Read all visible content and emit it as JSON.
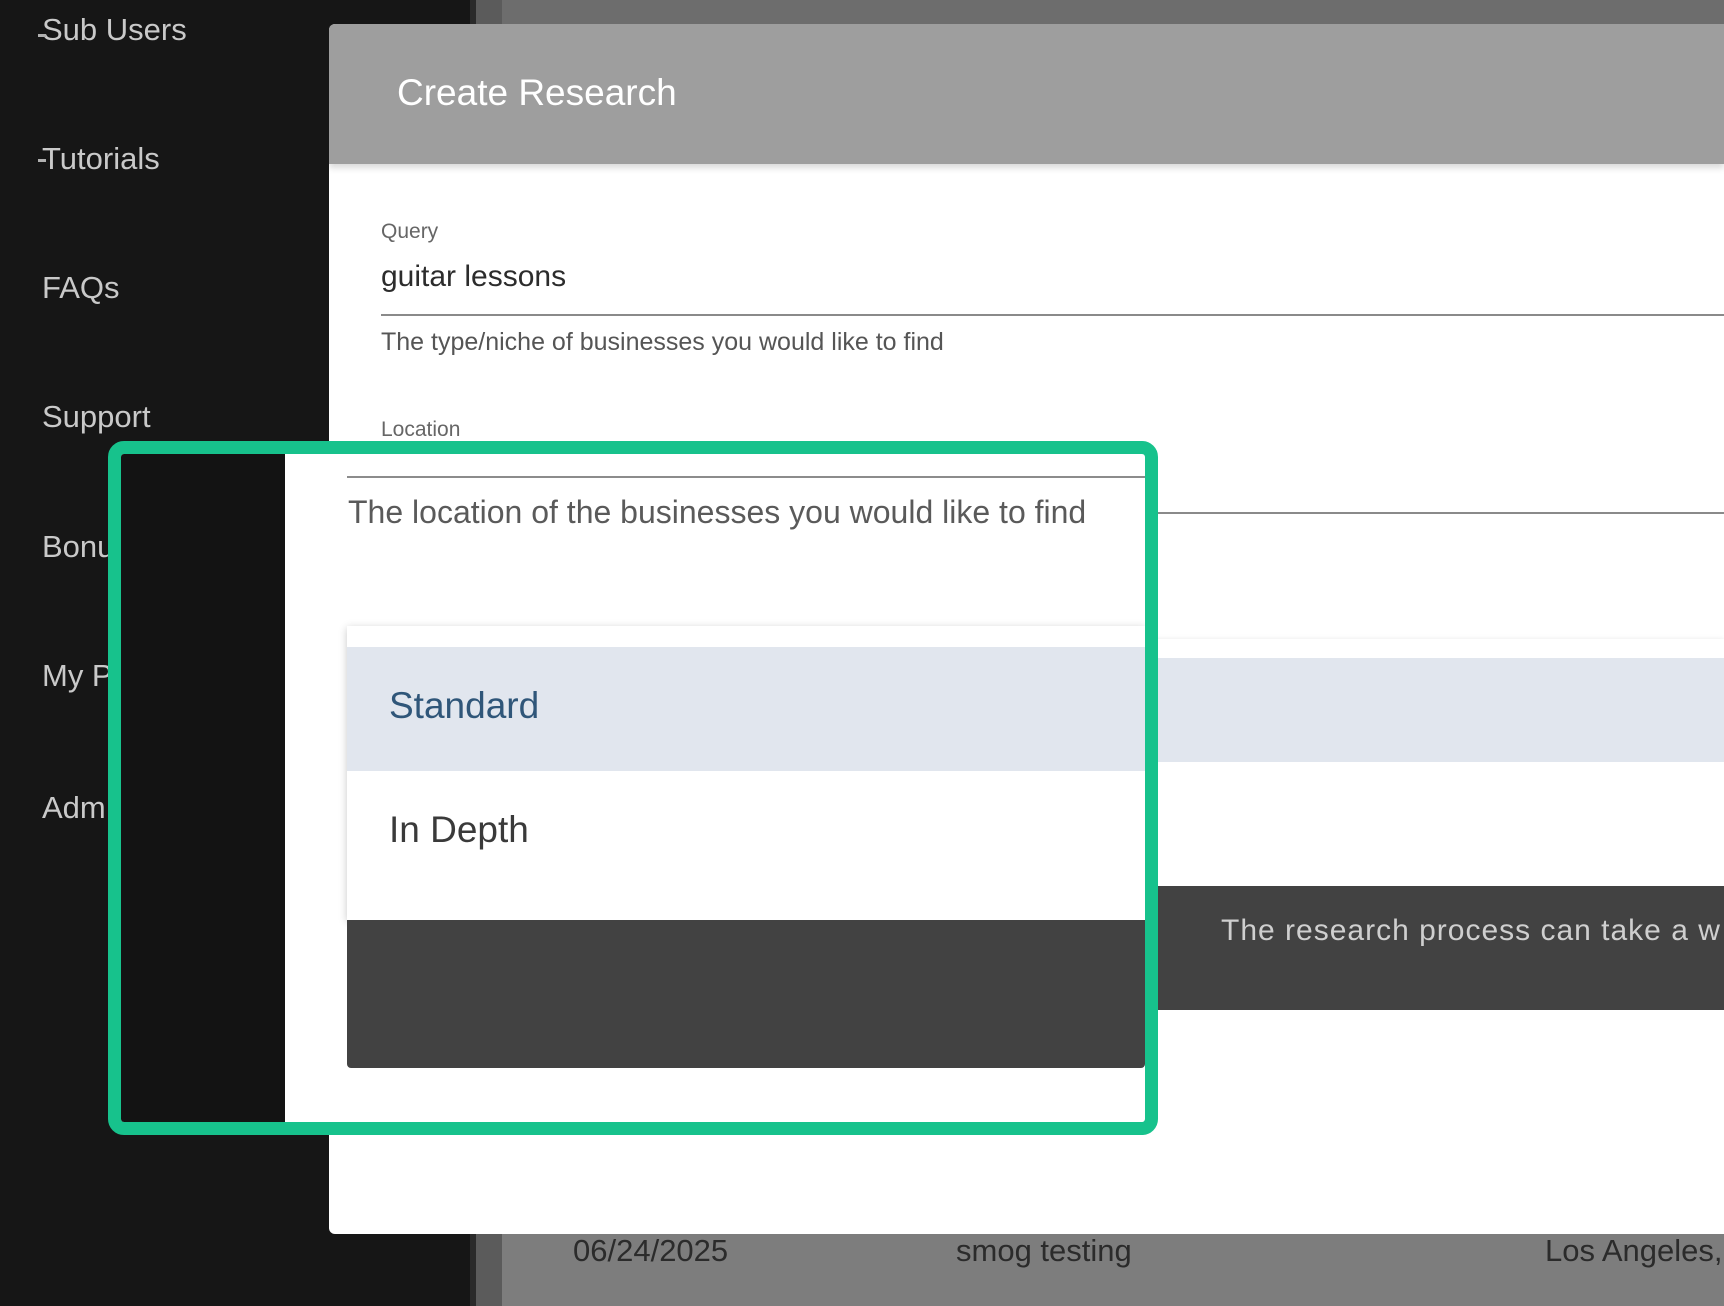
{
  "sidebar": {
    "items": [
      {
        "label": "Sub Users"
      },
      {
        "label": "Tutorials"
      },
      {
        "label": "FAQs"
      },
      {
        "label": "Support"
      },
      {
        "label": "Bonu"
      },
      {
        "label": "My P"
      },
      {
        "label": "Adm"
      }
    ]
  },
  "modal": {
    "title": "Create Research",
    "query": {
      "label": "Query",
      "value": "guitar lessons",
      "hint": "The type/niche of businesses you would like to find"
    },
    "location": {
      "label": "Location",
      "hint": "The location of the businesses you would like to find"
    },
    "research_type": {
      "options": [
        "Standard",
        "In Depth"
      ],
      "selected": "Standard"
    },
    "notice": "The research process can take a w"
  },
  "background_table": {
    "row": {
      "date": "06/24/2025",
      "name": "smog testing",
      "location": "Los Angeles,C"
    }
  },
  "colors": {
    "highlight_frame": "#17c28c",
    "modal_header": "#9e9e9e",
    "selected_option_bg": "#e1e6ee",
    "selected_option_text": "#2f5679"
  }
}
